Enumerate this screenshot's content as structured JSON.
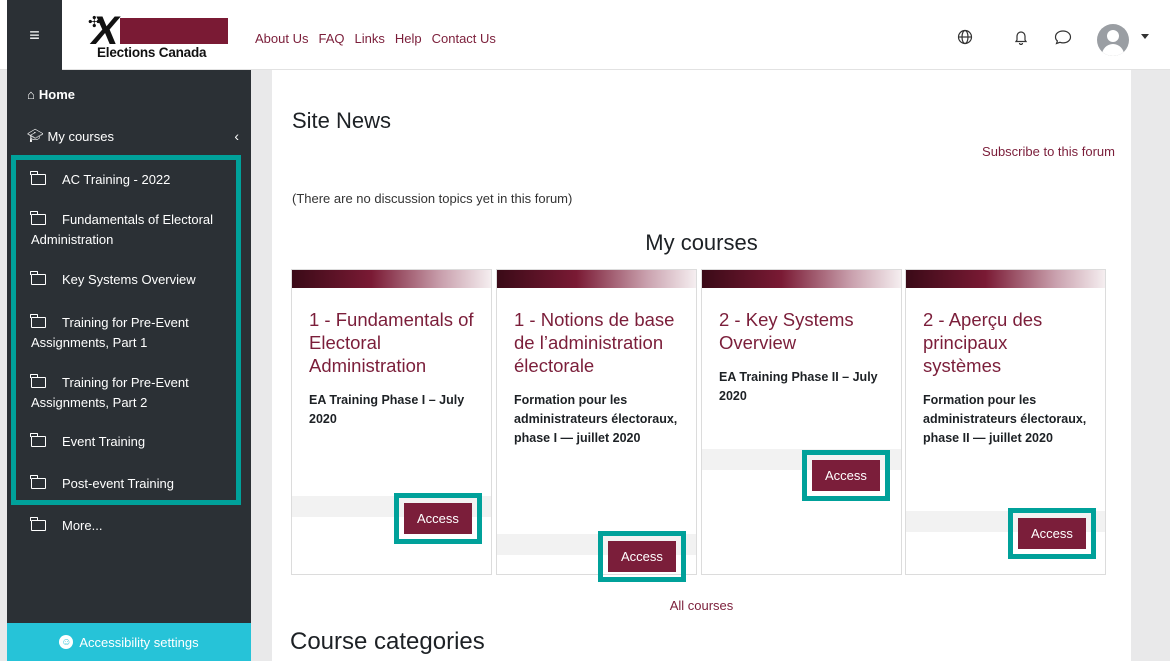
{
  "header": {
    "menu_glyph": "≡",
    "logo_text": "Elections Canada",
    "nav": [
      "About Us",
      "FAQ",
      "Links",
      "Help",
      "Contact Us"
    ],
    "icons": [
      "globe-icon",
      "bell-icon",
      "chat-icon",
      "user-avatar",
      "caret-down-icon"
    ]
  },
  "sidebar": {
    "home": "Home",
    "my_courses": "My courses",
    "items": [
      {
        "label": "AC Training - 2022"
      },
      {
        "label": "Fundamentals of Electoral Administration"
      },
      {
        "label": "Key Systems Overview"
      },
      {
        "label": "Training for Pre-Event Assignments, Part 1"
      },
      {
        "label": "Training for Pre-Event Assignments, Part 2"
      },
      {
        "label": "Event Training"
      },
      {
        "label": "Post-event Training"
      },
      {
        "label": "More..."
      }
    ],
    "accessibility": "Accessibility settings"
  },
  "main": {
    "site_news": "Site News",
    "subscribe": "Subscribe to this forum",
    "no_topics": "(There are no discussion topics yet in this forum)",
    "my_courses": "My courses",
    "courses": [
      {
        "title": "1 - Fundamentals of Electoral Administration",
        "subtitle": "EA Training Phase I – July 2020",
        "button": "Access"
      },
      {
        "title": "1 - Notions de base de l’administration électorale",
        "subtitle": "Formation pour les administrateurs électoraux, phase I — juillet 2020",
        "button": "Access"
      },
      {
        "title": "2 - Key Systems Overview",
        "subtitle": "EA Training Phase II – July 2020",
        "button": "Access"
      },
      {
        "title": "2 - Aperçu des principaux systèmes",
        "subtitle": "Formation pour les administrateurs électoraux, phase II — juillet 2020",
        "button": "Access"
      }
    ],
    "all_courses": "All courses",
    "course_categories": "Course categories"
  }
}
